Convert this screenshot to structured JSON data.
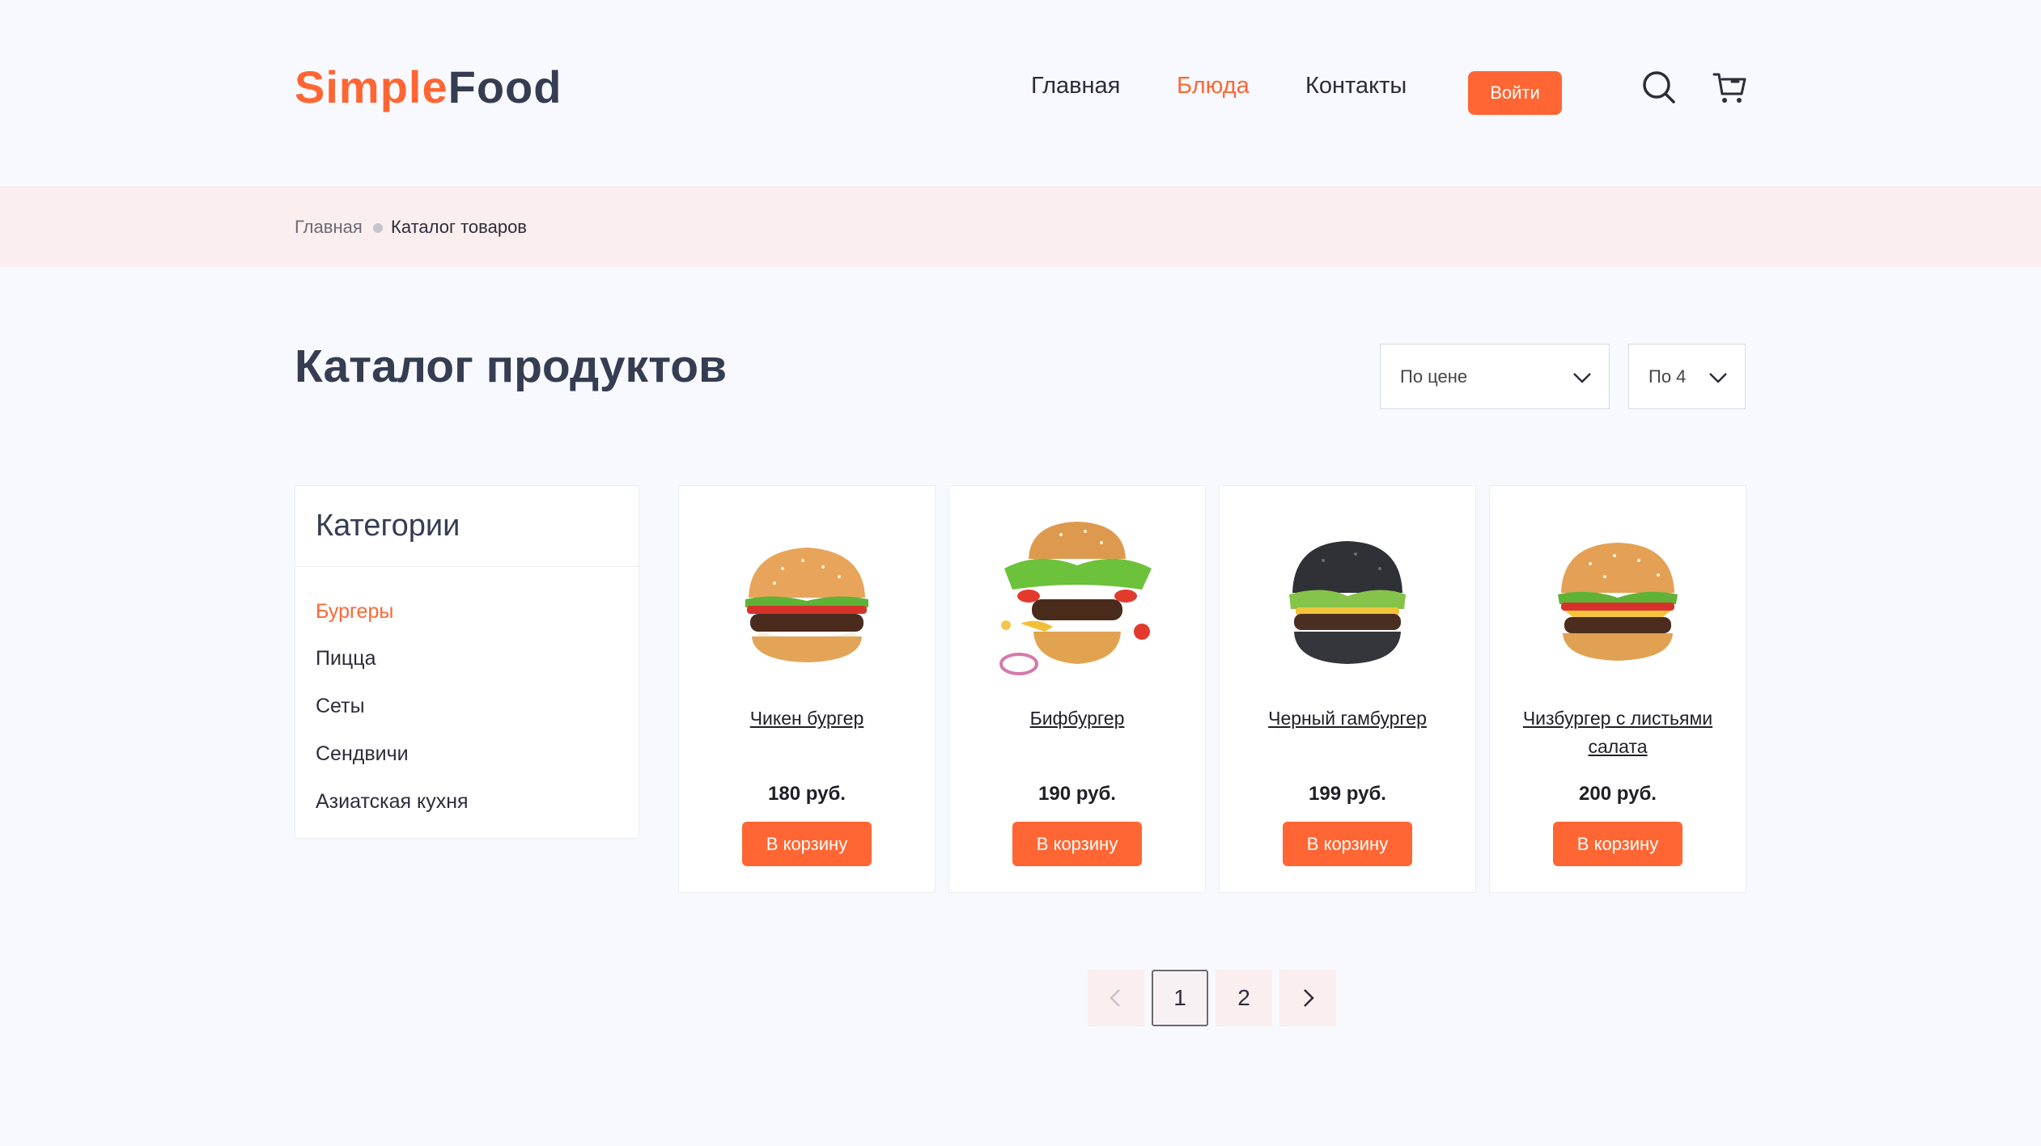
{
  "logo": {
    "part1": "Simple",
    "part2": "Food"
  },
  "nav": {
    "home": "Главная",
    "dishes": "Блюда",
    "contacts": "Контакты",
    "login": "Войти"
  },
  "breadcrumb": {
    "home": "Главная",
    "current": "Каталог товаров"
  },
  "page": {
    "title": "Каталог продуктов"
  },
  "controls": {
    "sort": "По цене",
    "per_page": "По 4"
  },
  "categories": {
    "title": "Категории",
    "items": [
      "Бургеры",
      "Пицца",
      "Сеты",
      "Сендвичи",
      "Азиатская кухня"
    ],
    "active": "Бургеры"
  },
  "products": [
    {
      "name": "Чикен бургер",
      "price": "180 руб.",
      "button": "В корзину"
    },
    {
      "name": "Бифбургер",
      "price": "190 руб.",
      "button": "В корзину"
    },
    {
      "name": "Черный гамбургер",
      "price": "199 руб.",
      "button": "В корзину"
    },
    {
      "name": "Чизбургер с листьями салата",
      "price": "200 руб.",
      "button": "В корзину"
    }
  ],
  "pagination": {
    "pages": [
      "1",
      "2"
    ],
    "current": "1"
  },
  "colors": {
    "accent": "#ff6633",
    "band": "#fbeeee",
    "text": "#2d2c3a"
  }
}
